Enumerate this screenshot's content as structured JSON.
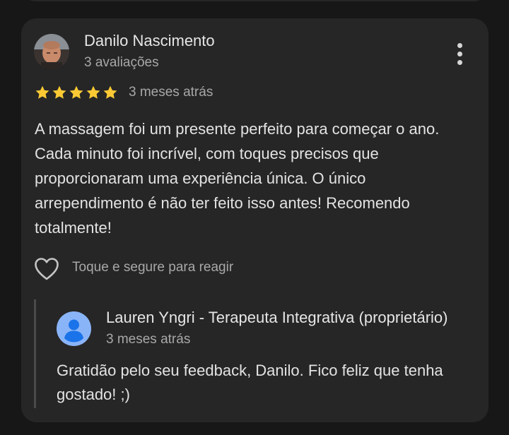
{
  "review": {
    "author_name": "Danilo Nascimento",
    "author_meta": "3 avaliações",
    "rating": 5,
    "time": "3 meses atrás",
    "text": "A massagem foi um presente perfeito para começar o ano. Cada minuto foi incrível, com toques precisos que proporcionaram uma experiência única. O único arrependimento é não ter feito isso antes! Recomendo totalmente!",
    "react_label": "Toque e segure para reagir"
  },
  "owner_reply": {
    "name": "Lauren Yngri - Terapeuta Integrativa (proprietário)",
    "time": "3 meses atrás",
    "text": "Gratidão pelo seu feedback, Danilo. Fico feliz que tenha gostado! ;)"
  },
  "colors": {
    "background": "#171717",
    "card": "#262626",
    "star": "#fcc934",
    "owner_avatar": "#8ab4f8"
  },
  "icons": {
    "more": "more-vert-icon",
    "star": "star-icon",
    "react": "heart-outline-icon",
    "owner_avatar": "person-icon"
  }
}
